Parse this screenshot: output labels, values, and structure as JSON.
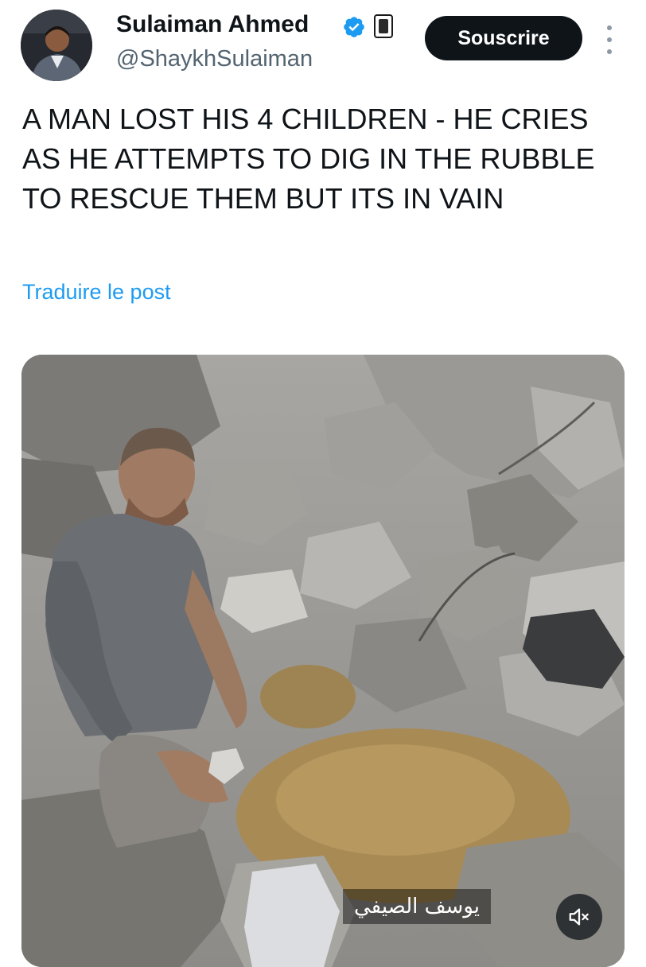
{
  "post": {
    "author": {
      "display_name": "Sulaiman Ahmed",
      "handle": "@ShaykhSulaiman",
      "verified": true
    },
    "subscribe_label": "Souscrire",
    "text": "A MAN LOST HIS 4 CHILDREN - HE CRIES AS HE ATTEMPTS TO DIG IN THE RUBBLE TO RESCUE THEM BUT ITS IN VAIN",
    "translate_label": "Traduire le post",
    "media": {
      "type": "video",
      "caption_overlay": "يوسف الصيفي",
      "muted": true
    }
  },
  "icons": {
    "verified": "verified-check-icon",
    "affiliate": "affiliate-badge-icon",
    "more": "more-options-icon",
    "mute": "speaker-muted-icon"
  },
  "colors": {
    "text_primary": "#0f1419",
    "text_secondary": "#536471",
    "link": "#1d9bf0",
    "verified": "#1d9bf0",
    "button_bg": "#0f1419",
    "button_text": "#ffffff"
  }
}
